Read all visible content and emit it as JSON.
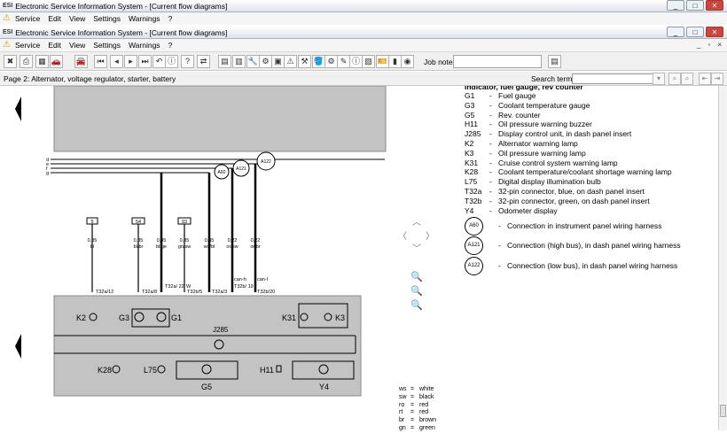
{
  "window_outer": {
    "title": "Electronic Service Information System - [Current flow diagrams]",
    "menu": [
      "Service",
      "Edit",
      "View",
      "Settings",
      "Warnings",
      "?"
    ]
  },
  "window_inner": {
    "title": "Electronic Service Information System - [Current flow diagrams]",
    "menu": [
      "Service",
      "Edit",
      "View",
      "Settings",
      "Warnings",
      "?"
    ]
  },
  "toolbar": {
    "job_note_label": "Job note:",
    "job_note_value": "",
    "icons": [
      "exit-icon",
      "print-icon",
      "document-icon",
      "vehicle-icon",
      "car-icon",
      "first-page-icon",
      "prev-page-icon",
      "next-page-icon",
      "last-page-icon",
      "back-icon",
      "info-icon",
      "help-icon",
      "swap-icon",
      "calendar-icon",
      "notes-icon",
      "wrench-icon",
      "gear-red-icon",
      "image-icon",
      "warning-icon",
      "tools-icon",
      "bucket-icon",
      "settings-icon",
      "pen-icon",
      "search-info-icon",
      "add-doc-icon",
      "ticket-icon",
      "book-icon",
      "globe-icon"
    ]
  },
  "status": {
    "page_label": "Page 2: Alternator, voltage regulator, starter, battery",
    "search_label": "Search term:",
    "search_value": ""
  },
  "legend": {
    "heading_cut": "Indicator, fuel gauge, rev counter",
    "items": [
      {
        "code": "G1",
        "desc": "Fuel gauge"
      },
      {
        "code": "G3",
        "desc": "Coolant temperature gauge"
      },
      {
        "code": "G5",
        "desc": "Rev. counter"
      },
      {
        "code": "H11",
        "desc": "Oil pressure warning buzzer"
      },
      {
        "code": "J285",
        "desc": "Display control unit, in dash panel insert"
      },
      {
        "code": "K2",
        "desc": "Alternator warning lamp"
      },
      {
        "code": "K3",
        "desc": "Oil pressure warning lamp"
      },
      {
        "code": "K31",
        "desc": "Cruise control system warning lamp"
      },
      {
        "code": "K28",
        "desc": "Coolant temperature/coolant shortage warning lamp"
      },
      {
        "code": "L75",
        "desc": "Digital display illumination bulb"
      },
      {
        "code": "T32a",
        "desc": "32-pin connector, blue, on dash panel insert"
      },
      {
        "code": "T32b",
        "desc": "32-pin connector, green, on dash panel insert"
      },
      {
        "code": "Y4",
        "desc": "Odometer display"
      }
    ],
    "connections": [
      {
        "code": "A60",
        "desc": "Connection in instrument panel wiring harness"
      },
      {
        "code": "A121",
        "desc": "Connection (high bus), in dash panel wiring harness"
      },
      {
        "code": "A122",
        "desc": "Connection (low bus), in dash panel wiring harness"
      }
    ],
    "dash": "-"
  },
  "colour_codes": [
    {
      "abbr": "ws",
      "name": "white"
    },
    {
      "abbr": "sw",
      "name": "black"
    },
    {
      "abbr": "ro",
      "name": "red"
    },
    {
      "abbr": "rt",
      "name": "red"
    },
    {
      "abbr": "br",
      "name": "brown"
    },
    {
      "abbr": "gn",
      "name": "green"
    }
  ],
  "diagram": {
    "bus_labels": [
      "d",
      "e",
      "f",
      "g"
    ],
    "fuse_boxes": [
      "5",
      "54",
      "93"
    ],
    "wires": [
      {
        "size": "0,35",
        "colour": "bl",
        "pin": "T32a/12"
      },
      {
        "size": "0,35",
        "colour": "bl/br",
        "pin": "T32a/8"
      },
      {
        "size": "0,35",
        "colour": "bl/ge",
        "pin": "T32a/ 22"
      },
      {
        "size": "0,35",
        "colour": "gn/sw",
        "pin": "T32b/5"
      },
      {
        "size": "0,35",
        "colour": "ws/bl",
        "pin": "T32a/3"
      },
      {
        "size": "0,22",
        "colour": "or/sw",
        "pin": "T32b/ 19"
      },
      {
        "size": "0,22",
        "colour": "or/br",
        "pin": "T32b/20"
      }
    ],
    "extra_labels": [
      "W",
      "can-h",
      "can-l"
    ],
    "conn_markers": [
      "A60",
      "A121",
      "A122"
    ],
    "components": [
      "K2",
      "G3",
      "G1",
      "K31",
      "K3",
      "J285",
      "K28",
      "L75",
      "G5",
      "H11",
      "Y4"
    ]
  }
}
